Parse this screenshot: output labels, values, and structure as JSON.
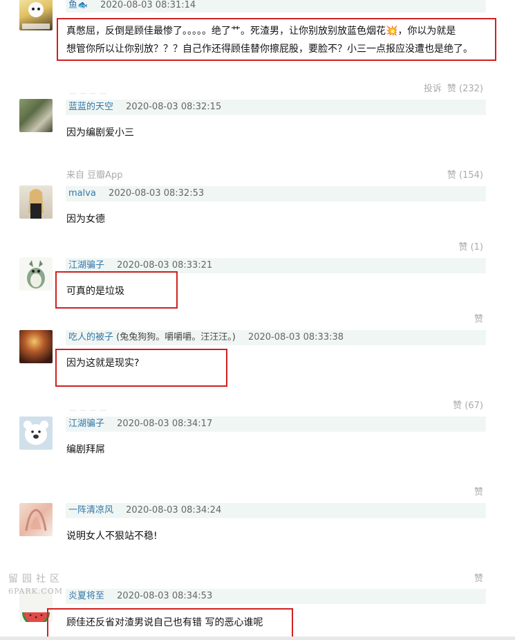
{
  "comments": [
    {
      "user": "鱼",
      "time": "2020-08-03 08:31:14",
      "content_line1": "真憋屈，反倒是顾佳最惨了。。。。。绝了艹。死渣男，让你别放别放蓝色烟花💥，你以为就是",
      "content_line2": "想管你所以让你别放？？？自己作还得顾佳替你擦屁股，要脸不？小三一点报应没遭也是绝了。",
      "report": "投诉",
      "like": "赞 (232)"
    },
    {
      "user": "蓝蓝的天空",
      "time": "2020-08-03 08:32:15",
      "content": "因为编剧爱小三",
      "source": "来自 豆瓣App",
      "like": "赞 (154)"
    },
    {
      "user": "malva",
      "time": "2020-08-03 08:32:53",
      "content": "因为女德",
      "like": "赞 (1)"
    },
    {
      "user": "江湖骗子",
      "time": "2020-08-03 08:33:21",
      "content": "可真的是垃圾",
      "like": "赞"
    },
    {
      "user": "吃人的被子",
      "user_extra": "(兔兔狗狗。嚼嚼嚼。汪汪汪。)",
      "time": "2020-08-03 08:33:38",
      "content": "因为这就是现实?",
      "like": "赞 (67)"
    },
    {
      "user": "江湖骗子",
      "time": "2020-08-03 08:34:17",
      "content": "编剧拜屌",
      "like": "赞"
    },
    {
      "user": "一阵清凉风",
      "time": "2020-08-03 08:34:24",
      "content": "说明女人不狠站不稳!",
      "like": "赞"
    },
    {
      "user": "炎夏将至",
      "time": "2020-08-03 08:34:53",
      "content": "顾佳还反省对渣男说自己也有错 写的恶心谁呢"
    }
  ],
  "watermark": {
    "line1": "留园社区",
    "line2": "6PARK.COM"
  },
  "colors": {
    "link": "#3377aa",
    "highlight": "#d11f1f",
    "meta_bg": "#f0f6f3"
  }
}
